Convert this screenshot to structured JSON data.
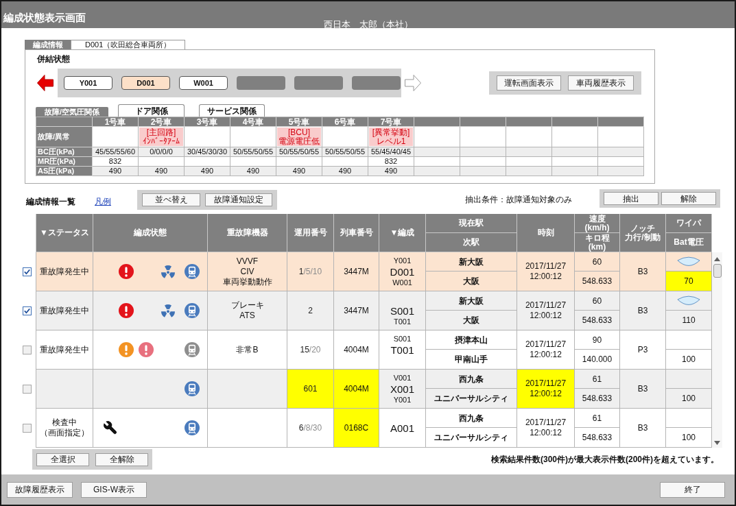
{
  "window": {
    "title": "編成状態表示画面",
    "user": "西日本　太郎（本社）"
  },
  "formation_info": {
    "tab_label": "編成情報",
    "value": "D001（吹田総合車両所）",
    "coupling": {
      "title": "併結状態",
      "left_arrow": {
        "active": true
      },
      "right_arrow": {
        "active": false
      },
      "units": [
        {
          "kind": "unit",
          "label": "Y001",
          "selected": false
        },
        {
          "kind": "unit",
          "label": "D001",
          "selected": true
        },
        {
          "kind": "unit",
          "label": "W001",
          "selected": false
        },
        {
          "kind": "empty"
        },
        {
          "kind": "empty"
        },
        {
          "kind": "empty"
        }
      ]
    },
    "buttons": [
      "運転画面表示",
      "車両履歴表示"
    ],
    "tabs": [
      {
        "label": "故障/空気圧関係",
        "selected": true
      },
      {
        "label": "ドア関係",
        "selected": false
      },
      {
        "label": "サービス関係",
        "selected": false
      }
    ],
    "car_table": {
      "columns": [
        "1号車",
        "2号車",
        "3号車",
        "4号車",
        "5号車",
        "6号車",
        "7号車"
      ],
      "rows": [
        {
          "kind": "fault",
          "label": "故障/異常",
          "cells": [
            null,
            [
              "[主回路]",
              "ｲﾝﾊﾞｰﾀｱｰﾑ"
            ],
            null,
            null,
            [
              "[BCU]",
              "電源電圧低"
            ],
            null,
            [
              "[異常挙動]",
              "レベル1"
            ]
          ]
        },
        {
          "kind": "value",
          "label": "BC圧(kPa)",
          "cells": [
            "45/55/55/60",
            "0/0/0/0",
            "30/45/30/30",
            "50/55/50/55",
            "50/55/50/55",
            "50/55/50/55",
            "55/45/40/45"
          ]
        },
        {
          "kind": "value",
          "label": "MR圧(kPa)",
          "cells": [
            "832",
            null,
            null,
            null,
            null,
            null,
            "832"
          ]
        },
        {
          "kind": "value",
          "label": "AS圧(kPa)",
          "cells": [
            "490",
            "490",
            "490",
            "490",
            "490",
            "490",
            "490"
          ]
        }
      ]
    }
  },
  "list": {
    "title": "編成情報一覧",
    "legend_link": "凡例",
    "buttons": [
      "並べ替え",
      "故障通知設定"
    ],
    "filter": "抽出条件：故障通知対象のみ",
    "filter_buttons": [
      "抽出",
      "解除"
    ],
    "columns": [
      {
        "kind": "single",
        "lines": [
          "▼ステータス"
        ]
      },
      {
        "kind": "single",
        "lines": [
          "編成状態"
        ]
      },
      {
        "kind": "single",
        "lines": [
          "重故障機器"
        ]
      },
      {
        "kind": "single",
        "lines": [
          "運用番号"
        ]
      },
      {
        "kind": "single",
        "lines": [
          "列車番号"
        ]
      },
      {
        "kind": "single",
        "lines": [
          "▼編成"
        ]
      },
      {
        "kind": "split",
        "top": [
          "現在駅"
        ],
        "bottom": [
          "次駅"
        ]
      },
      {
        "kind": "single",
        "lines": [
          "時刻"
        ]
      },
      {
        "kind": "split",
        "top": [
          "速度",
          "(km/h)"
        ],
        "bottom": [
          "キロ程",
          "(km)"
        ]
      },
      {
        "kind": "single",
        "lines": [
          "ノッチ",
          "力行/制動"
        ]
      },
      {
        "kind": "split",
        "top": [
          "ワイパ"
        ],
        "bottom": [
          "Bat電圧"
        ]
      }
    ],
    "rows": [
      {
        "checked": true,
        "selected": true,
        "status": [
          "重故障発生中"
        ],
        "icons": [
          {
            "kind": "critical"
          },
          {
            "kind": "trefoil"
          }
        ],
        "vehicle_icon": {
          "active": true
        },
        "equipment": [
          "VVVF",
          "CIV",
          "車両挙動動作"
        ],
        "operation_no": {
          "text": "1/5/10",
          "highlighted": false
        },
        "train_no": {
          "text": "3447M",
          "highlighted": false
        },
        "formation": {
          "front": "Y001",
          "main": "D001",
          "rear": "W001"
        },
        "station": {
          "current": "新大阪",
          "next": "大阪"
        },
        "time": {
          "date": "2017/11/27",
          "clock": "12:00:12",
          "highlighted": false
        },
        "speed": "60",
        "distance": "548.633",
        "notch": "B3",
        "wiper_on": true,
        "battery": {
          "text": "70",
          "highlighted": true
        }
      },
      {
        "checked": true,
        "selected": false,
        "status": [
          "重故障発生中"
        ],
        "icons": [
          {
            "kind": "critical"
          },
          {
            "kind": "trefoil"
          }
        ],
        "vehicle_icon": {
          "active": true
        },
        "equipment": [
          "ブレーキ",
          "ATS"
        ],
        "operation_no": {
          "text": "2",
          "highlighted": false
        },
        "train_no": {
          "text": "3447M",
          "highlighted": false
        },
        "formation": {
          "main": "S001",
          "rear": "T001"
        },
        "station": {
          "current": "新大阪",
          "next": "大阪"
        },
        "time": {
          "date": "2017/11/27",
          "clock": "12:00:12",
          "highlighted": false
        },
        "speed": "60",
        "distance": "548.633",
        "notch": "B3",
        "wiper_on": true,
        "battery": {
          "text": "110",
          "highlighted": false
        }
      },
      {
        "checked": false,
        "selected": false,
        "status": [
          "重故障発生中"
        ],
        "icons": [
          {
            "kind": "warning"
          },
          {
            "kind": "minor"
          }
        ],
        "vehicle_icon": {
          "active": false
        },
        "equipment": [
          "非常B"
        ],
        "operation_no": {
          "text": "15/20",
          "highlighted": false
        },
        "train_no": {
          "text": "4004M",
          "highlighted": false
        },
        "formation": {
          "front": "S001",
          "main": "T001"
        },
        "station": {
          "current": "摂津本山",
          "next": "甲南山手"
        },
        "time": {
          "date": "2017/11/27",
          "clock": "12:00:12",
          "highlighted": false
        },
        "speed": "90",
        "distance": "140.000",
        "notch": "P3",
        "wiper_on": false,
        "battery": {
          "text": "100",
          "highlighted": false
        }
      },
      {
        "checked": false,
        "selected": false,
        "vehicle_icon": {
          "active": true
        },
        "operation_no": {
          "text": "601",
          "highlighted": true
        },
        "train_no": {
          "text": "4004M",
          "highlighted": true
        },
        "formation": {
          "front": "V001",
          "main": "X001",
          "rear": "Y001"
        },
        "station": {
          "current": "西九条",
          "next": "ユニバーサルシティ"
        },
        "time": {
          "date": "2017/11/27",
          "clock": "12:00:12",
          "highlighted": true
        },
        "speed": "61",
        "distance": "548.633",
        "notch": "B3",
        "wiper_on": false,
        "battery": {
          "text": "100",
          "highlighted": false
        }
      },
      {
        "checked": false,
        "selected": false,
        "status": [
          "検査中",
          "（画面指定）"
        ],
        "icons": [
          {
            "kind": "wrench"
          }
        ],
        "vehicle_icon": {
          "active": true
        },
        "operation_no": {
          "text": "6/8/30",
          "highlighted": false
        },
        "train_no": {
          "text": "0168C",
          "highlighted": true
        },
        "formation": {
          "main": "A001"
        },
        "station": {
          "current": "西九条",
          "next": "ユニバーサルシティ"
        },
        "time": {
          "date": "2017/11/27",
          "clock": "12:00:12",
          "highlighted": false
        },
        "speed": "61",
        "distance": "548.633",
        "notch": "B3",
        "wiper_on": false,
        "battery": {
          "text": "100",
          "highlighted": false
        }
      }
    ],
    "select_buttons": [
      "全選択",
      "全解除"
    ],
    "notice": "検索結果件数(300件)が最大表示件数(200件)を超えています。"
  },
  "footer": {
    "buttons_left": [
      "故障履歴表示",
      "GIS-W表示"
    ],
    "buttons_right": [
      "終了"
    ]
  }
}
